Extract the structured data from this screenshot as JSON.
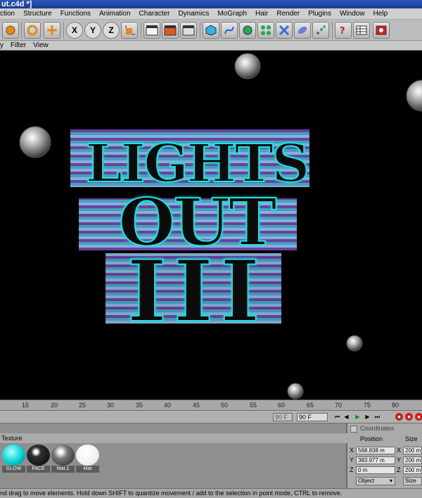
{
  "window": {
    "title": "ut.c4d *]"
  },
  "menu": [
    "ction",
    "Structure",
    "Functions",
    "Animation",
    "Character",
    "Dynamics",
    "MoGraph",
    "Hair",
    "Render",
    "Plugins",
    "Window",
    "Help"
  ],
  "toolbar": {
    "icons": [
      "undo-icon",
      "rotate-icon",
      "move-icon",
      "x-axis-icon",
      "y-axis-icon",
      "z-axis-icon",
      "object-axis-icon",
      "render-view-icon",
      "render-picture-icon",
      "render-settings-icon",
      "cube-icon",
      "spline-icon",
      "nurbs-icon",
      "array-icon",
      "deformer-icon",
      "environment-icon",
      "scene-icon",
      "help-icon",
      "table-icon",
      "camera-icon"
    ],
    "axis_labels": [
      "X",
      "Y",
      "Z"
    ]
  },
  "viewport_menu": [
    "y",
    "Filter",
    "View"
  ],
  "viewport": {
    "lines": [
      "LIGHTS",
      "OUT",
      "III"
    ]
  },
  "timeline": {
    "ticks": [
      "15",
      "20",
      "25",
      "30",
      "35",
      "40",
      "45",
      "50",
      "55",
      "60",
      "65",
      "70",
      "75",
      "80"
    ]
  },
  "transport": {
    "frame_display": "90 F",
    "current_frame": "90 F"
  },
  "materials": {
    "header": "Texture",
    "items": [
      {
        "label": "GLOW",
        "color": "#00d2d4"
      },
      {
        "label": "FACE",
        "color": "#101010"
      },
      {
        "label": "Mat.1",
        "color": "#777777"
      },
      {
        "label": "Mat",
        "color": "#ffffff"
      }
    ]
  },
  "coordinates": {
    "title": "Coordinates",
    "position_label": "Position",
    "size_label": "Size",
    "rows": [
      {
        "axis": "X",
        "pos": "568.838 m",
        "saxis": "X",
        "size": "200 m"
      },
      {
        "axis": "Y",
        "pos": "383.977 m",
        "saxis": "Y",
        "size": "200 m"
      },
      {
        "axis": "Z",
        "pos": "0 m",
        "saxis": "Z",
        "size": "200 m"
      }
    ],
    "mode": "Object",
    "size_mode": "Size"
  },
  "status": {
    "text": "nd drag to move elements. Hold down SHIFT to quantize movement / add to the selection in point mode, CTRL to remove."
  }
}
